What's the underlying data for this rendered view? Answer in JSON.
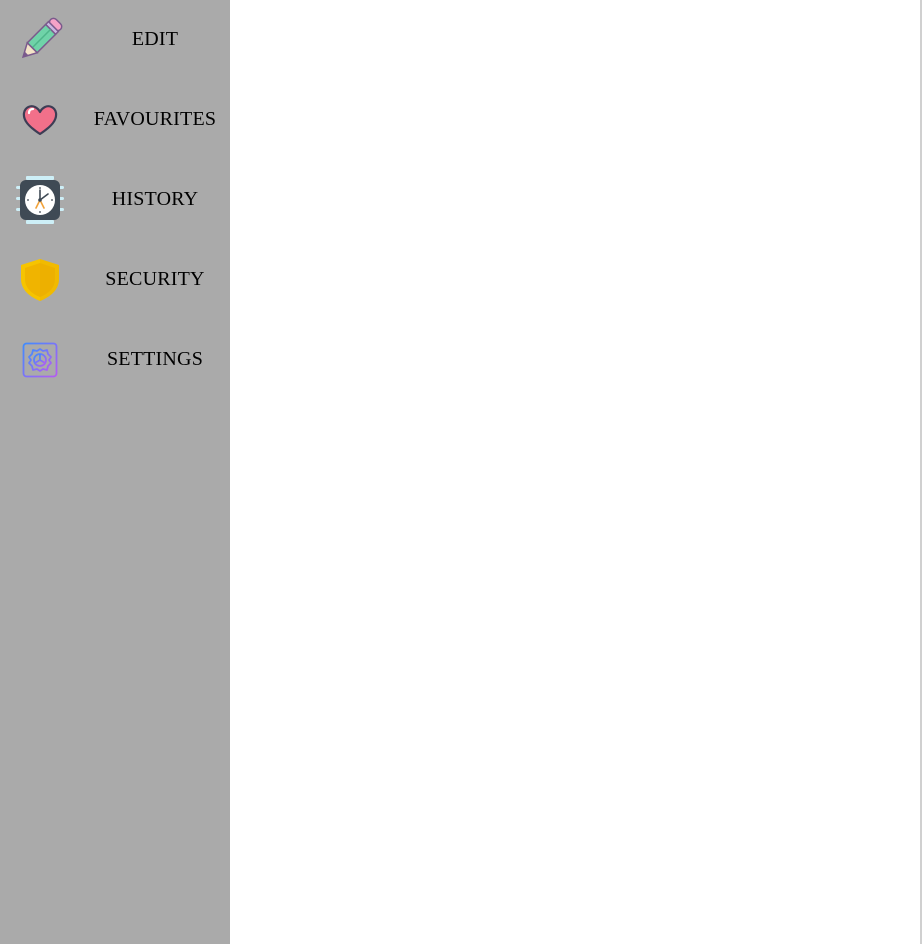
{
  "sidebar": {
    "background": "#aaaaaa",
    "items": [
      {
        "label": "EDIT",
        "icon": "pencil-icon"
      },
      {
        "label": "FAVOURITES",
        "icon": "heart-icon"
      },
      {
        "label": "HISTORY",
        "icon": "clock-icon"
      },
      {
        "label": "SECURITY",
        "icon": "shield-icon"
      },
      {
        "label": "SETTINGS",
        "icon": "gear-icon"
      }
    ]
  },
  "content": {
    "background": "#ffffff"
  }
}
